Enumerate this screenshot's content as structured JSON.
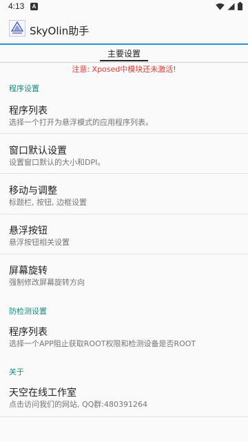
{
  "status": {
    "time": "4:13",
    "notification_letter": "A"
  },
  "app": {
    "title": "SkyOlin助手"
  },
  "tabs": [
    {
      "label": "主要设置"
    }
  ],
  "warning": "注意: Xposed中模块还未激活!",
  "sections": [
    {
      "header": "程序设置",
      "items": [
        {
          "title": "程序列表",
          "summary": "选择一个打开为悬浮模式的应用程序列表。"
        },
        {
          "title": "窗口默认设置",
          "summary": "设置窗口默认的大小和DPI。"
        },
        {
          "title": "移动与调整",
          "summary": "标题栏, 按钮, 边框设置"
        },
        {
          "title": "悬浮按钮",
          "summary": "悬浮按钮相关设置"
        },
        {
          "title": "屏幕旋转",
          "summary": "强制修改屏幕旋转方向"
        }
      ]
    },
    {
      "header": "防检测设置",
      "items": [
        {
          "title": "程序列表",
          "summary": "选择一个APP阻止获取ROOT权限和检测设备是否ROOT"
        }
      ]
    },
    {
      "header": "关于",
      "items": [
        {
          "title": "天空在线工作室",
          "summary": "点击访问我们的网站, QQ群:480391264"
        }
      ]
    }
  ],
  "colors": {
    "accent": "#1a8a7c",
    "warning": "#e53935",
    "app_bar_line": "#2196d3"
  }
}
